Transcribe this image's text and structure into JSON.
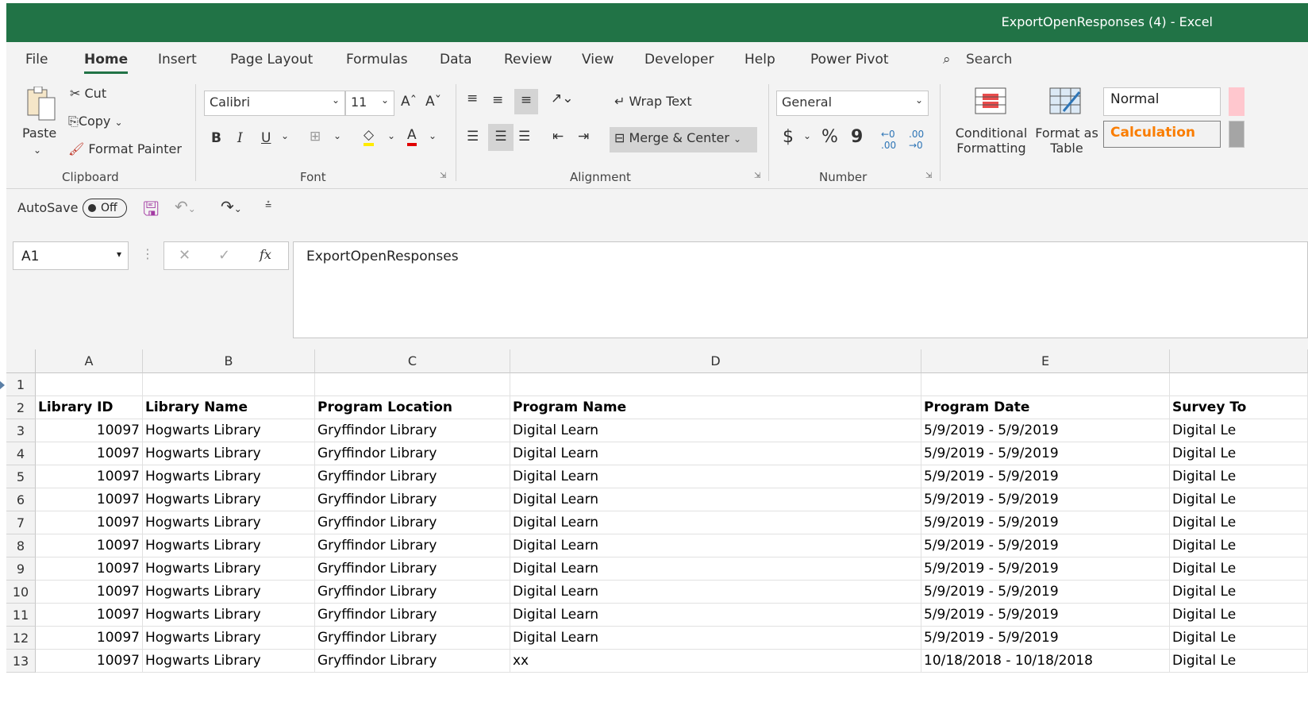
{
  "window": {
    "title": "ExportOpenResponses (4)  -  Excel",
    "accent": "#217346"
  },
  "tabs": [
    "File",
    "Home",
    "Insert",
    "Page Layout",
    "Formulas",
    "Data",
    "Review",
    "View",
    "Developer",
    "Help",
    "Power Pivot"
  ],
  "active_tab": "Home",
  "search": {
    "label": "Search",
    "icon": "search-icon"
  },
  "ribbon": {
    "clipboard": {
      "paste": "Paste",
      "cut": "Cut",
      "copy": "Copy",
      "format_painter": "Format Painter",
      "label": "Clipboard"
    },
    "font": {
      "name": "Calibri",
      "size": "11",
      "label": "Font",
      "bold": "B",
      "italic": "I",
      "underline": "U",
      "font_color": "A"
    },
    "alignment": {
      "wrap_text": "Wrap Text",
      "merge_center": "Merge & Center",
      "label": "Alignment"
    },
    "number": {
      "format": "General",
      "currency": "$",
      "percent": "%",
      "comma": "9",
      "label": "Number"
    },
    "styles": {
      "conditional_formatting_1": "Conditional",
      "conditional_formatting_2": "Formatting",
      "format_table_1": "Format as",
      "format_table_2": "Table",
      "normal": "Normal",
      "calculation": "Calculation",
      "calc_color": "#fa7d00"
    }
  },
  "qat": {
    "autosave": "AutoSave",
    "toggle": "Off"
  },
  "formula_bar": {
    "name_box": "A1",
    "fx": "fx",
    "content": "ExportOpenResponses"
  },
  "columns": [
    "A",
    "B",
    "C",
    "D",
    "E",
    ""
  ],
  "rows": [
    {
      "n": "1",
      "cells": [
        "",
        "",
        "",
        "",
        "",
        ""
      ]
    },
    {
      "n": "2",
      "header": true,
      "cells": [
        "Library ID",
        "Library Name",
        "Program Location",
        "Program Name",
        "Program Date",
        "Survey To"
      ]
    },
    {
      "n": "3",
      "cells": [
        "10097",
        "Hogwarts Library",
        "Gryffindor Library",
        "Digital Learn",
        "5/9/2019 - 5/9/2019",
        "Digital Le"
      ]
    },
    {
      "n": "4",
      "cells": [
        "10097",
        "Hogwarts Library",
        "Gryffindor Library",
        "Digital Learn",
        "5/9/2019 - 5/9/2019",
        "Digital Le"
      ]
    },
    {
      "n": "5",
      "cells": [
        "10097",
        "Hogwarts Library",
        "Gryffindor Library",
        "Digital Learn",
        "5/9/2019 - 5/9/2019",
        "Digital Le"
      ]
    },
    {
      "n": "6",
      "cells": [
        "10097",
        "Hogwarts Library",
        "Gryffindor Library",
        "Digital Learn",
        "5/9/2019 - 5/9/2019",
        "Digital Le"
      ]
    },
    {
      "n": "7",
      "cells": [
        "10097",
        "Hogwarts Library",
        "Gryffindor Library",
        "Digital Learn",
        "5/9/2019 - 5/9/2019",
        "Digital Le"
      ]
    },
    {
      "n": "8",
      "cells": [
        "10097",
        "Hogwarts Library",
        "Gryffindor Library",
        "Digital Learn",
        "5/9/2019 - 5/9/2019",
        "Digital Le"
      ]
    },
    {
      "n": "9",
      "cells": [
        "10097",
        "Hogwarts Library",
        "Gryffindor Library",
        "Digital Learn",
        "5/9/2019 - 5/9/2019",
        "Digital Le"
      ]
    },
    {
      "n": "10",
      "cells": [
        "10097",
        "Hogwarts Library",
        "Gryffindor Library",
        "Digital Learn",
        "5/9/2019 - 5/9/2019",
        "Digital Le"
      ]
    },
    {
      "n": "11",
      "cells": [
        "10097",
        "Hogwarts Library",
        "Gryffindor Library",
        "Digital Learn",
        "5/9/2019 - 5/9/2019",
        "Digital Le"
      ]
    },
    {
      "n": "12",
      "cells": [
        "10097",
        "Hogwarts Library",
        "Gryffindor Library",
        "Digital Learn",
        "5/9/2019 - 5/9/2019",
        "Digital Le"
      ]
    },
    {
      "n": "13",
      "cells": [
        "10097",
        "Hogwarts Library",
        "Gryffindor Library",
        "xx",
        "10/18/2018 - 10/18/2018",
        "Digital Le"
      ]
    }
  ]
}
